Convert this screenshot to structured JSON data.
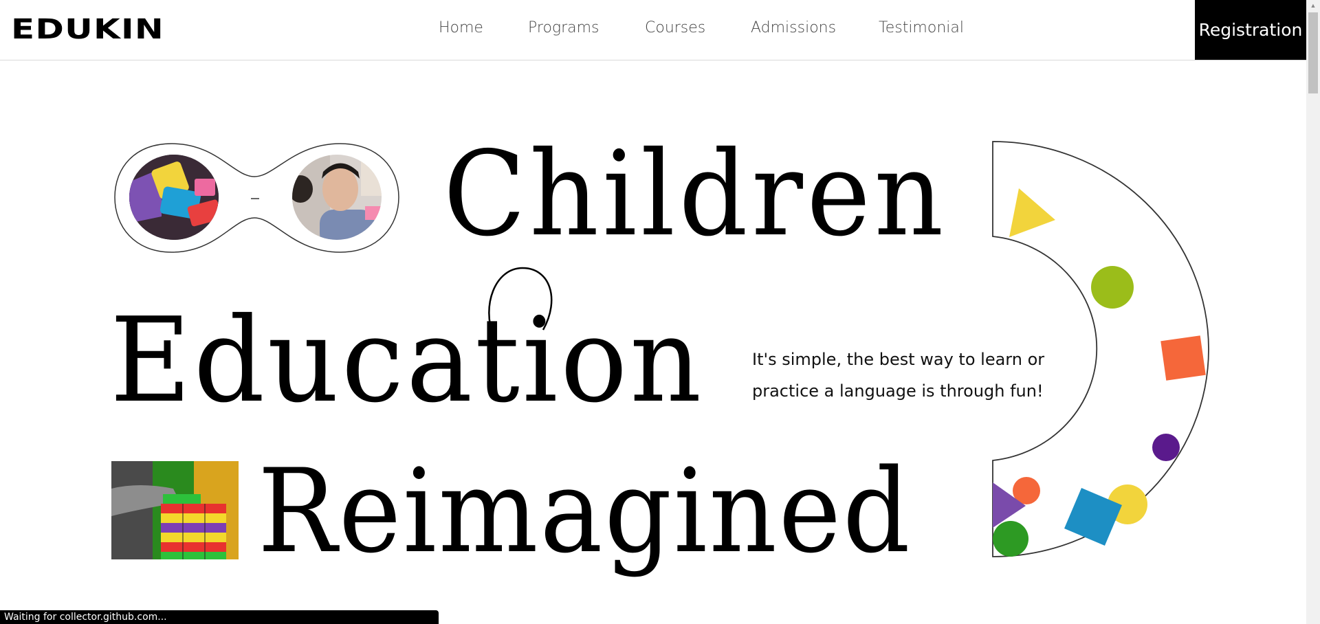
{
  "header": {
    "logo": "EDUKIN",
    "nav": [
      {
        "label": "Home"
      },
      {
        "label": "Programs"
      },
      {
        "label": "Courses"
      },
      {
        "label": "Admissions"
      },
      {
        "label": "Testimonial"
      }
    ],
    "registration_label": "Registration"
  },
  "hero": {
    "line1": "Children",
    "line2": "Education",
    "line3": "Reimagined",
    "tagline_line1": "It's simple, the best way to learn or",
    "tagline_line2": "practice a language is through fun!"
  },
  "status_bar": {
    "text": "Waiting for collector.github.com..."
  },
  "colors": {
    "yellow": "#f2d43c",
    "lime": "#9bbd1a",
    "orange": "#f5673a",
    "purple": "#5a1a8c",
    "violet": "#7a4bab",
    "blue": "#1d8fc4",
    "green": "#2d9a23",
    "nav_text": "#444444",
    "button_bg": "#000000"
  }
}
